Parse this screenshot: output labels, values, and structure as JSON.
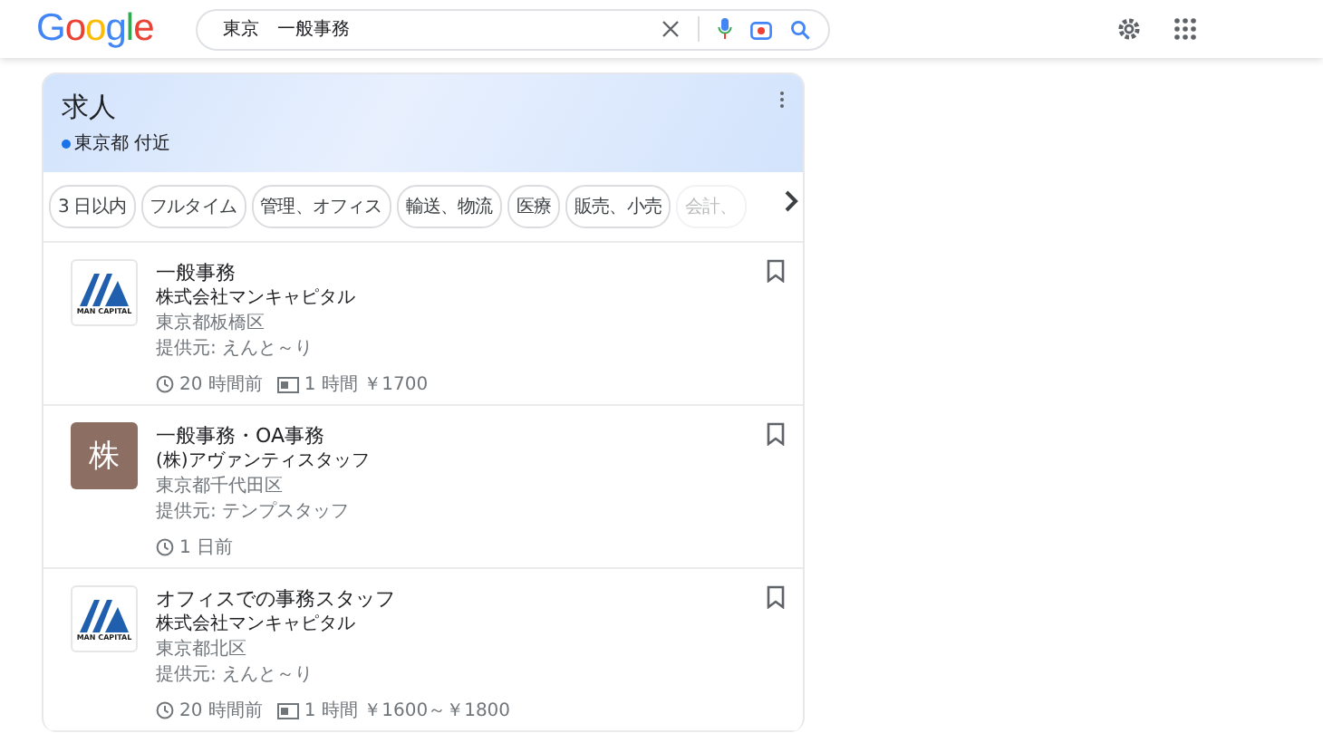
{
  "header": {
    "logo": "Google",
    "search": {
      "value": "東京　一般事務"
    }
  },
  "jobs_panel": {
    "title": "求人",
    "location": "東京都 付近",
    "filters": [
      "3 日以内",
      "フルタイム",
      "管理、オフィス",
      "輸送、物流",
      "医療",
      "販売、小売",
      "会計、"
    ],
    "listings": [
      {
        "title": "一般事務",
        "company": "株式会社マンキャピタル",
        "place": "東京都板橋区",
        "provider": "提供元: えんと～り",
        "posted": "20 時間前",
        "pay": "1 時間 ￥1700",
        "logo": {
          "kind": "mountain",
          "text": "MAN CAPITAL"
        }
      },
      {
        "title": "一般事務・OA事務",
        "company": "(株)アヴァンティスタッフ",
        "place": "東京都千代田区",
        "provider": "提供元: テンプスタッフ",
        "posted": "1 日前",
        "logo": {
          "kind": "letter",
          "text": "株"
        }
      },
      {
        "title": "オフィスでの事務スタッフ",
        "company": "株式会社マンキャピタル",
        "place": "東京都北区",
        "provider": "提供元: えんと～り",
        "posted": "20 時間前",
        "pay": "1 時間 ￥1600～￥1800",
        "logo": {
          "kind": "mountain",
          "text": "MAN CAPITAL"
        }
      }
    ]
  }
}
